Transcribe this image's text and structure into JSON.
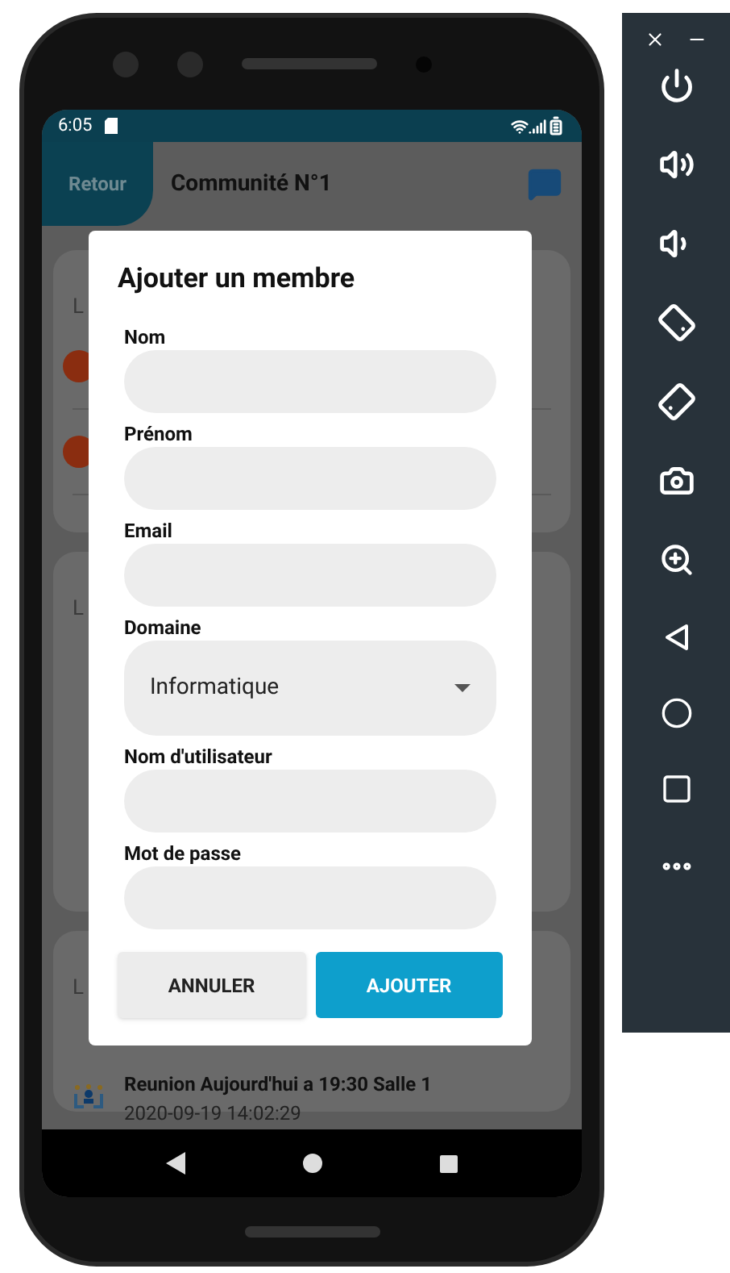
{
  "status_bar": {
    "time": "6:05"
  },
  "header": {
    "back": "Retour",
    "title": "Communité N°1"
  },
  "cards": [
    {
      "heading": "L",
      "entries": [
        {
          "kind": "avatar"
        },
        {
          "kind": "avatar"
        }
      ]
    },
    {
      "heading": "L"
    },
    {
      "heading": "L",
      "entries": [
        {
          "kind": "event",
          "title": "Reunion Aujourd'hui a 19:30 Salle 1",
          "time": "2020-09-19 14:02:29"
        }
      ]
    }
  ],
  "dialog": {
    "title": "Ajouter un membre",
    "fields": [
      {
        "label": "Nom",
        "kind": "text"
      },
      {
        "label": "Prénom",
        "kind": "text"
      },
      {
        "label": "Email",
        "kind": "email"
      },
      {
        "label": "Domaine",
        "kind": "select",
        "value": "Informatique"
      },
      {
        "label": "Nom d'utilisateur",
        "kind": "text"
      },
      {
        "label": "Mot de passe",
        "kind": "password"
      }
    ],
    "buttons": [
      {
        "label": "ANNULER",
        "kind": "secondary"
      },
      {
        "label": "AJOUTER",
        "kind": "primary"
      }
    ]
  }
}
